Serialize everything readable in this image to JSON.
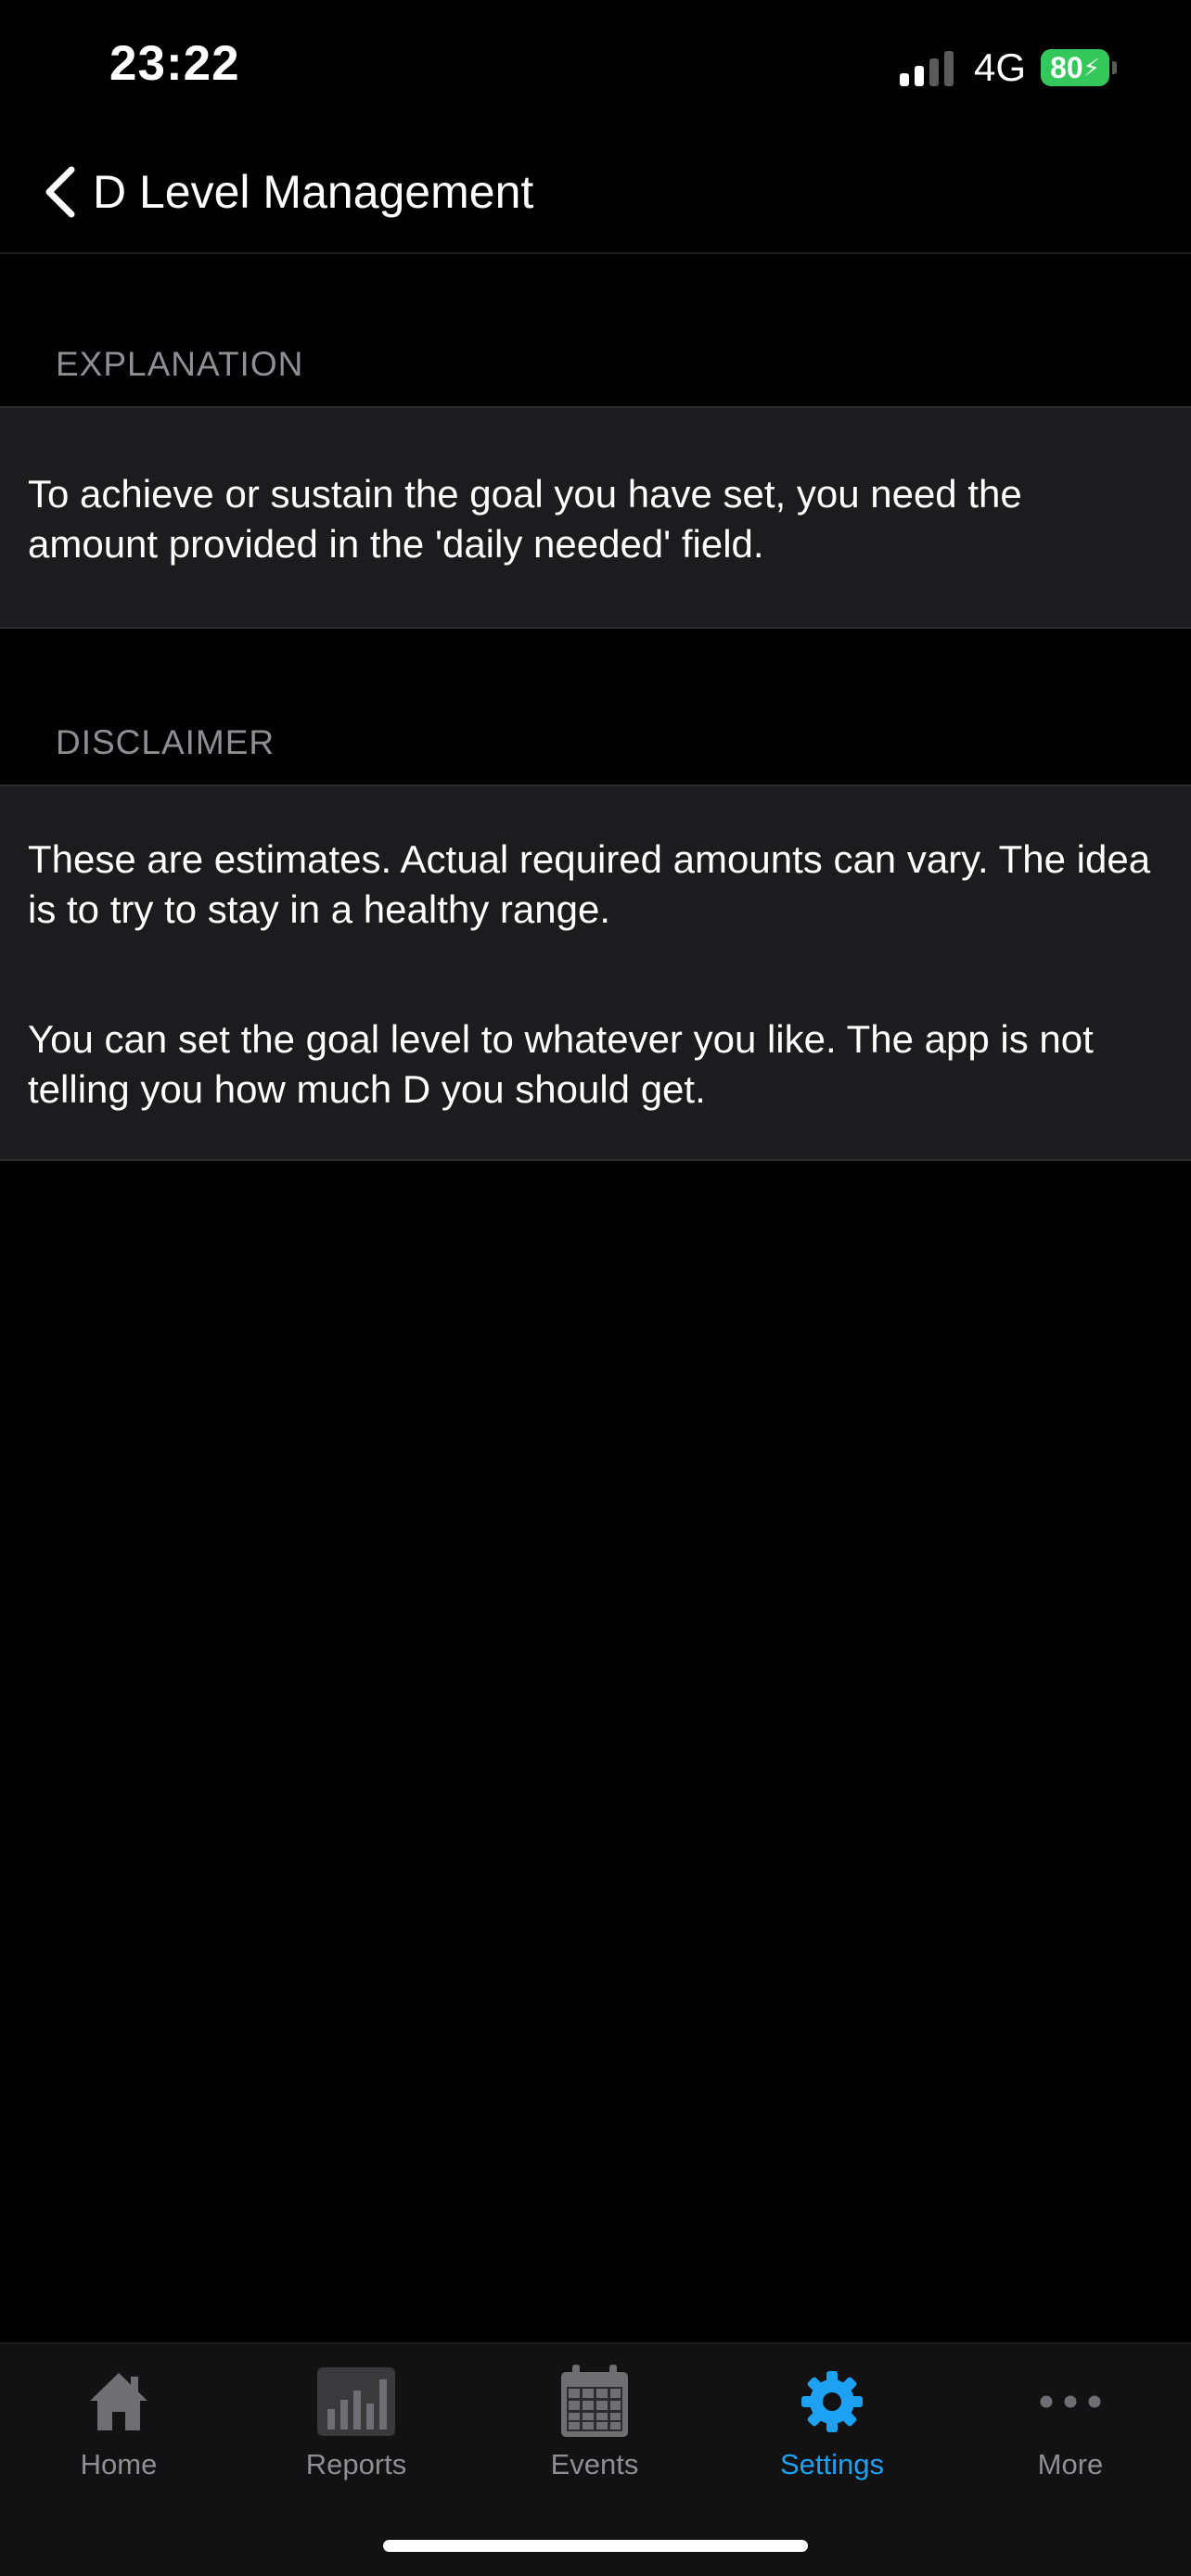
{
  "status_bar": {
    "time": "23:22",
    "network": "4G",
    "battery": "80"
  },
  "nav": {
    "title": "D Level Management",
    "back_icon": "chevron-left-icon"
  },
  "sections": {
    "explanation": {
      "header": "EXPLANATION",
      "body": "To achieve or sustain the goal you have set, you need the amount provided in the 'daily needed' field."
    },
    "disclaimer": {
      "header": "DISCLAIMER",
      "paragraph_1": "These are estimates. Actual required amounts can vary. The idea is to try to stay in a healthy range.",
      "paragraph_2": "You can set the goal level to whatever you like. The app is not telling you how much D you should get."
    }
  },
  "tabs": [
    {
      "label": "Home",
      "icon": "home-icon",
      "active": false
    },
    {
      "label": "Reports",
      "icon": "bar-chart-icon",
      "active": false
    },
    {
      "label": "Events",
      "icon": "calendar-icon",
      "active": false
    },
    {
      "label": "Settings",
      "icon": "gear-icon",
      "active": true
    },
    {
      "label": "More",
      "icon": "more-dots-icon",
      "active": false
    }
  ],
  "colors": {
    "accent": "#1da1f2",
    "battery": "#34c759",
    "inactive_tab": "#8e8e93",
    "card_bg": "#1c1c1e"
  }
}
